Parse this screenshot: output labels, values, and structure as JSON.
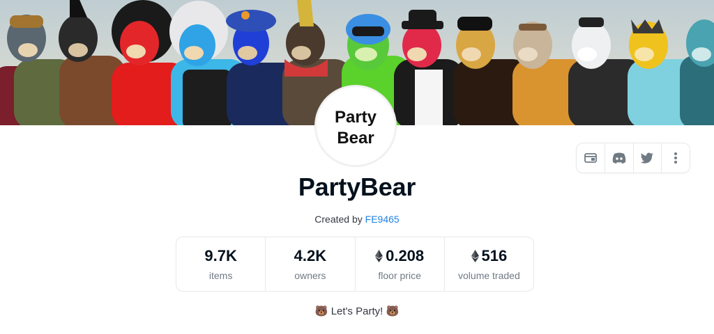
{
  "collection": {
    "name": "PartyBear",
    "logo_text_line1": "Party",
    "logo_text_line2": "Bear",
    "created_by_prefix": "Created by",
    "creator": "FE9465",
    "tagline": "🐻 Let's Party! 🐻"
  },
  "actions": {
    "icons": [
      "website-icon",
      "discord-icon",
      "twitter-icon",
      "more-options-icon"
    ]
  },
  "stats": [
    {
      "value": "9.7K",
      "label": "items",
      "eth": false
    },
    {
      "value": "4.2K",
      "label": "owners",
      "eth": false
    },
    {
      "value": "0.208",
      "label": "floor price",
      "eth": true
    },
    {
      "value": "516",
      "label": "volume traded",
      "eth": true
    }
  ],
  "colors": {
    "link": "#2081e2",
    "text": "#04111d",
    "muted": "#707a83",
    "border": "#e5e8eb"
  }
}
